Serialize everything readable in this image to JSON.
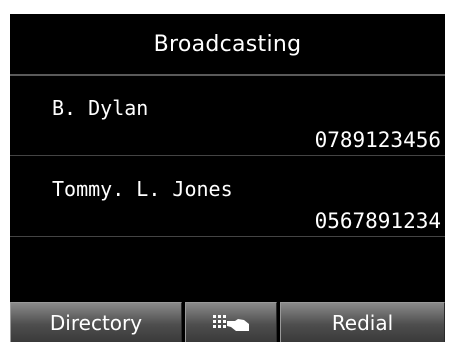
{
  "header": {
    "title": "Broadcasting"
  },
  "recipients": [
    {
      "name": "B. Dylan",
      "number": "0789123456"
    },
    {
      "name": "Tommy. L. Jones",
      "number": "0567891234"
    }
  ],
  "softkeys": {
    "left_label": "Directory",
    "center_icon": "dialpad-hand-icon",
    "right_label": "Redial"
  },
  "colors": {
    "background": "#000000",
    "text": "#ffffff",
    "divider": "#444444",
    "softkey": "#5a5a5a"
  }
}
